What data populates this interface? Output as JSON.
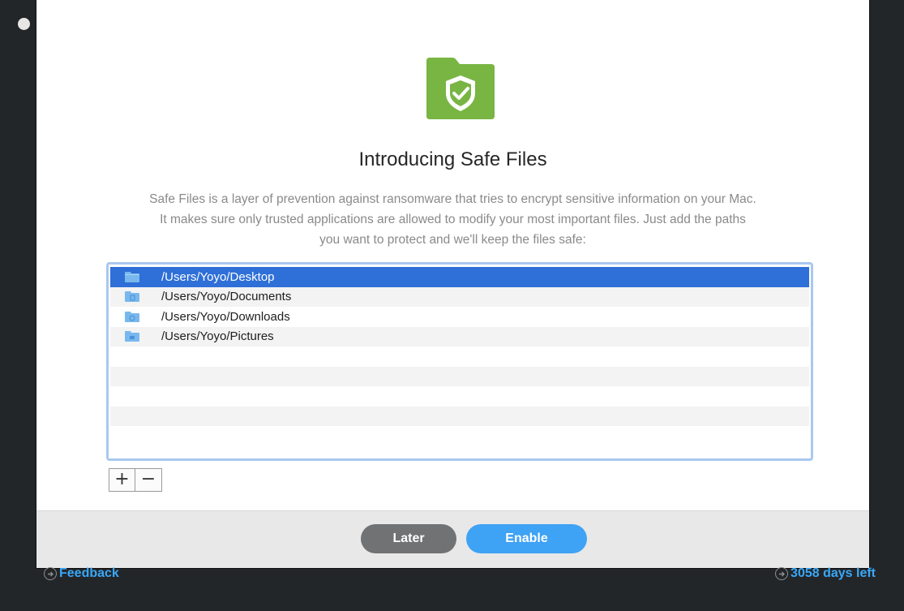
{
  "dialog": {
    "title": "Introducing Safe Files",
    "description_lines": [
      "Safe Files is a layer of prevention against ransomware that tries to encrypt sensitive information on your Mac.",
      "It makes sure only trusted applications are allowed to modify your most important files. Just add the paths",
      "you want to protect and we'll keep the files safe:"
    ],
    "hero_icon": "shield-folder-icon",
    "accent_color": "#79b543"
  },
  "paths": [
    {
      "path": "/Users/Yoyo/Desktop",
      "icon": "desktop-folder-icon",
      "selected": true
    },
    {
      "path": "/Users/Yoyo/Documents",
      "icon": "documents-folder-icon",
      "selected": false
    },
    {
      "path": "/Users/Yoyo/Downloads",
      "icon": "downloads-folder-icon",
      "selected": false
    },
    {
      "path": "/Users/Yoyo/Pictures",
      "icon": "pictures-folder-icon",
      "selected": false
    }
  ],
  "list_controls": {
    "add_label": "+",
    "remove_label": "−"
  },
  "buttons": {
    "later_label": "Later",
    "enable_label": "Enable"
  },
  "footer": {
    "feedback_label": "Feedback",
    "days_left_label": "3058 days left"
  }
}
